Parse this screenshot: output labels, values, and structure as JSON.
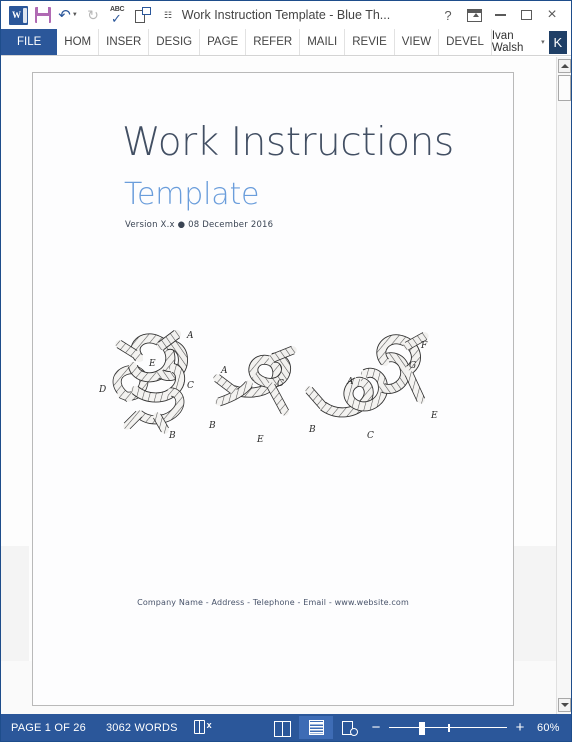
{
  "window": {
    "title": "Work Instruction Template - Blue Th...",
    "help_label": "?",
    "ribbon_display_label": "Ribbon Display Options",
    "minimize_label": "Minimize",
    "maximize_label": "Maximize",
    "close_label": "×"
  },
  "quick_access": {
    "app_letter": "W",
    "items": [
      {
        "name": "save",
        "label": "Save"
      },
      {
        "name": "undo",
        "label": "Undo"
      },
      {
        "name": "redo",
        "label": "Repeat"
      },
      {
        "name": "spelling",
        "label": "Spelling & Grammar",
        "glyph": "ABC",
        "check": "✔"
      },
      {
        "name": "print-preview",
        "label": "Print Preview and Print"
      },
      {
        "name": "customize",
        "label": "Customize Quick Access Toolbar",
        "glyph": "☷"
      }
    ]
  },
  "ribbon": {
    "tabs": [
      {
        "label": "FILE",
        "active": true
      },
      {
        "label": "HOM"
      },
      {
        "label": "INSER"
      },
      {
        "label": "DESIG"
      },
      {
        "label": "PAGE"
      },
      {
        "label": "REFER"
      },
      {
        "label": "MAILI"
      },
      {
        "label": "REVIE"
      },
      {
        "label": "VIEW"
      },
      {
        "label": "DEVEL"
      }
    ],
    "user_name": "Ivan Walsh",
    "user_caret": "▾",
    "avatar_initial": "K"
  },
  "document": {
    "title": "Work Instructions",
    "subtitle": "Template",
    "version_line": "Version X.x ● 08 December 2016",
    "footer": "Company Name - Address - Telephone - Email - www.website.com",
    "illustration_name": "rope-knots-engraving",
    "knot_labels": [
      "A",
      "B",
      "C",
      "D",
      "E",
      "F",
      "G"
    ]
  },
  "status_bar": {
    "page_indicator": "PAGE 1 OF 26",
    "word_count": "3062 WORDS",
    "proofing_label": "Proofing errors",
    "views": [
      {
        "name": "read-mode",
        "label": "Read Mode",
        "active": false
      },
      {
        "name": "print-layout",
        "label": "Print Layout",
        "active": true
      },
      {
        "name": "web-layout",
        "label": "Web Layout",
        "active": false
      }
    ],
    "zoom_out_label": "−",
    "zoom_in_label": "+",
    "zoom_value": "60%"
  },
  "scrollbar": {
    "up_label": "Scroll up",
    "down_label": "Scroll down",
    "thumb_label": "Scroll thumb"
  },
  "colors": {
    "word_blue": "#2b579a",
    "title_slate": "#424f63",
    "subtitle_blue": "#6a9ddb",
    "avatar_navy": "#1f3f66"
  }
}
